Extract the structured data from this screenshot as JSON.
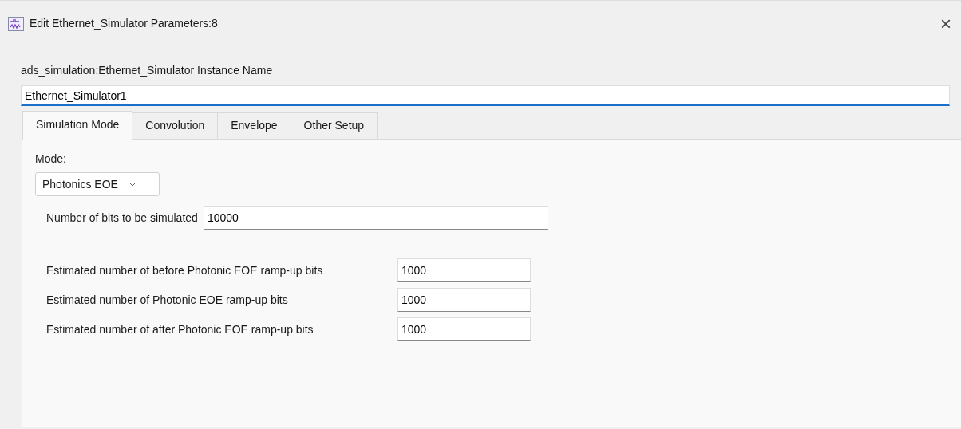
{
  "window": {
    "title": "Edit Ethernet_Simulator Parameters:8",
    "close": "×"
  },
  "instance": {
    "label": "ads_simulation:Ethernet_Simulator Instance Name",
    "value": "Ethernet_Simulator1"
  },
  "tabs": [
    {
      "label": "Simulation Mode",
      "selected": true
    },
    {
      "label": "Convolution",
      "selected": false
    },
    {
      "label": "Envelope",
      "selected": false
    },
    {
      "label": "Other Setup",
      "selected": false
    }
  ],
  "mode": {
    "label": "Mode:",
    "value": "Photonics EOE"
  },
  "bits": {
    "label": "Number of bits to be simulated",
    "value": "10000"
  },
  "rampup": [
    {
      "label": "Estimated number of before Photonic EOE ramp-up bits",
      "value": "1000"
    },
    {
      "label": "Estimated number of Photonic EOE ramp-up bits",
      "value": "1000"
    },
    {
      "label": "Estimated number of after Photonic EOE ramp-up bits",
      "value": "1000"
    }
  ]
}
